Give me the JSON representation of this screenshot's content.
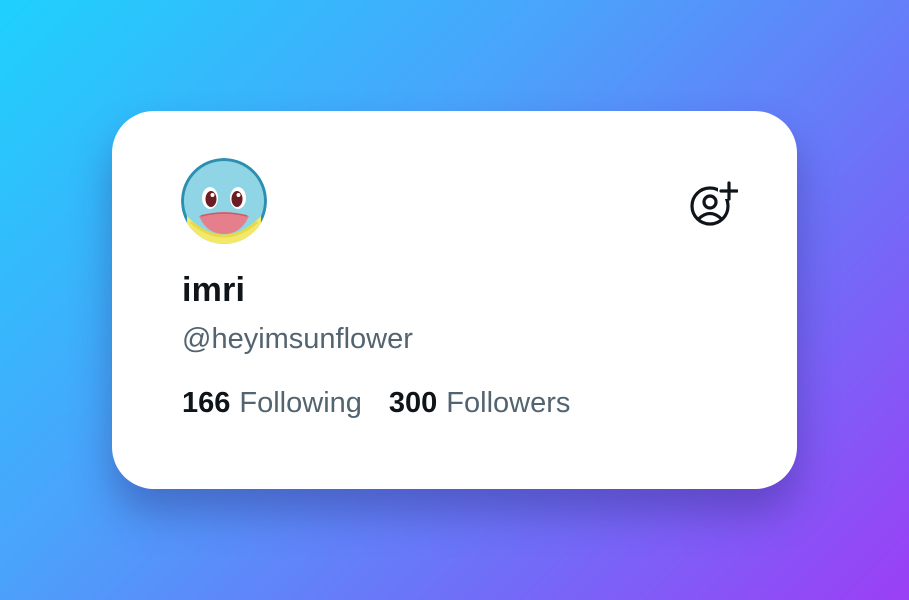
{
  "colors": {
    "background_gradient": [
      "#1ed1fd",
      "#4aa3fb",
      "#6f6ff8",
      "#9b3ff5"
    ],
    "card_background": "#ffffff",
    "primary_text": "#0f1419",
    "secondary_text": "#536471"
  },
  "profile": {
    "avatar_icon": "squirtle-face-avatar",
    "display_name": "imri",
    "handle": "@heyimsunflower"
  },
  "actions": {
    "follow_icon": "person-add-icon"
  },
  "stats": {
    "following_count": "166",
    "following_label": "Following",
    "followers_count": "300",
    "followers_label": "Followers"
  }
}
